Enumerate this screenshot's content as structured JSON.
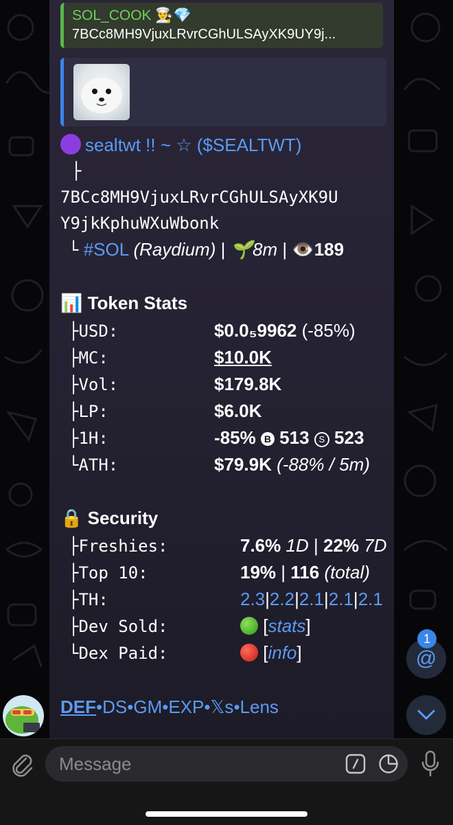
{
  "reply": {
    "title": "SOL_COOK 👨‍🍳💎",
    "text": "7BCc8MH9VjuxLRvrCGhULSAyXK9UY9j..."
  },
  "token": {
    "name": "sealtwt !! ~ ☆",
    "ticker": "($SEALTWT)",
    "branch": "├",
    "address_line1": "7BCc8MH9VjuxLRvrCGhULSAyXK9U",
    "address_line2": "Y9jkKphuWXuWbonk",
    "chain_branch": "└",
    "chain": "#SOL",
    "dex": "(Raydium)",
    "sep": "|",
    "age": "🌱8m",
    "views": "👁️189"
  },
  "token_stats": {
    "heading": "📊 Token Stats",
    "usd": {
      "label": "├USD:",
      "value": "$0.0₅9962",
      "change": "(-85%)"
    },
    "mc": {
      "label": "├MC:",
      "value": "$10.0K"
    },
    "vol": {
      "label": "├Vol:",
      "value": "$179.8K"
    },
    "lp": {
      "label": "├LP:",
      "value": "$6.0K"
    },
    "h1": {
      "label": "├1H:",
      "change": "-85%",
      "buy_icon": "B",
      "buys": "513",
      "sell_icon": "S",
      "sells": "523"
    },
    "ath": {
      "label": "└ATH:",
      "value": "$79.9K",
      "detail": "(-88% / 5m)"
    }
  },
  "security": {
    "heading": "🔒 Security",
    "freshies": {
      "label": "├Freshies:",
      "v1": "7.6%",
      "p1": "1D",
      "sep": "|",
      "v2": "22%",
      "p2": "7D"
    },
    "top10": {
      "label": "├Top 10:",
      "pct": "19%",
      "sep": "|",
      "count": "116",
      "note": "(total)"
    },
    "th": {
      "label": "├TH:",
      "values": [
        "2.3",
        "2.2",
        "2.1",
        "2.1",
        "2.1"
      ]
    },
    "dev_sold": {
      "label": "├Dev Sold:",
      "status": "green",
      "open": "[",
      "link": "stats",
      "close": "]"
    },
    "dex_paid": {
      "label": "└Dex Paid:",
      "status": "red",
      "open": "[",
      "link": "info",
      "close": "]"
    }
  },
  "links": {
    "items": [
      "DEF",
      "DS",
      "GM",
      "EXP",
      "𝕏s",
      "Lens"
    ],
    "dot": "•"
  },
  "mention_badge": "1",
  "composer": {
    "placeholder": "Message"
  },
  "colors": {
    "link_blue": "#5b9bf3",
    "quote_green": "#5ab54a",
    "bubble": "#252233",
    "background": "#07070a"
  }
}
